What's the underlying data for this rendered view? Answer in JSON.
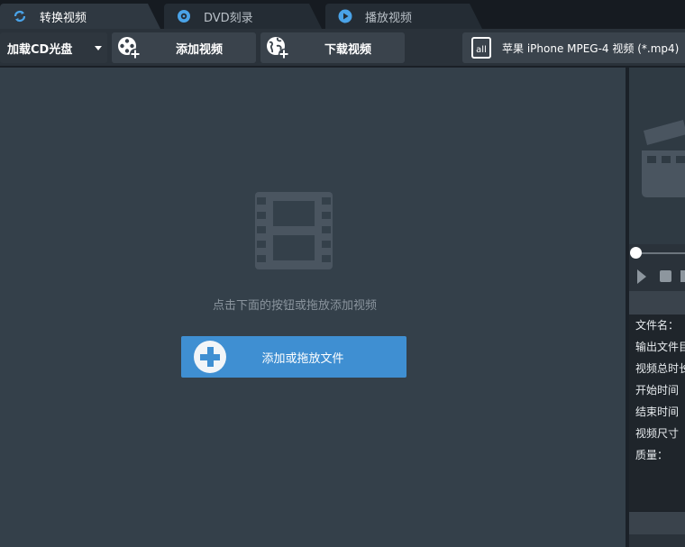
{
  "tabs": [
    {
      "label": "转换视频",
      "icon": "refresh-icon",
      "active": true
    },
    {
      "label": "DVD刻录",
      "icon": "disc-icon",
      "active": false
    },
    {
      "label": "播放视频",
      "icon": "play-circle-icon",
      "active": false
    }
  ],
  "toolbar": {
    "load_cd_label": "加载CD光盘",
    "add_video_label": "添加视频",
    "download_video_label": "下载视频",
    "format_label": "苹果 iPhone MPEG-4 视频 (*.mp4)"
  },
  "main": {
    "hint": "点击下面的按钮或拖放添加视频",
    "add_file_label": "添加或拖放文件"
  },
  "info": {
    "rows": [
      "文件名：",
      "输出文件目",
      "视频总时长",
      "开始时间",
      "结束时间",
      "视频尺寸",
      "质量："
    ]
  },
  "colors": {
    "accent": "#3f8fd2",
    "main_bg": "#34404a",
    "toolbar_bg": "#2a323a"
  }
}
